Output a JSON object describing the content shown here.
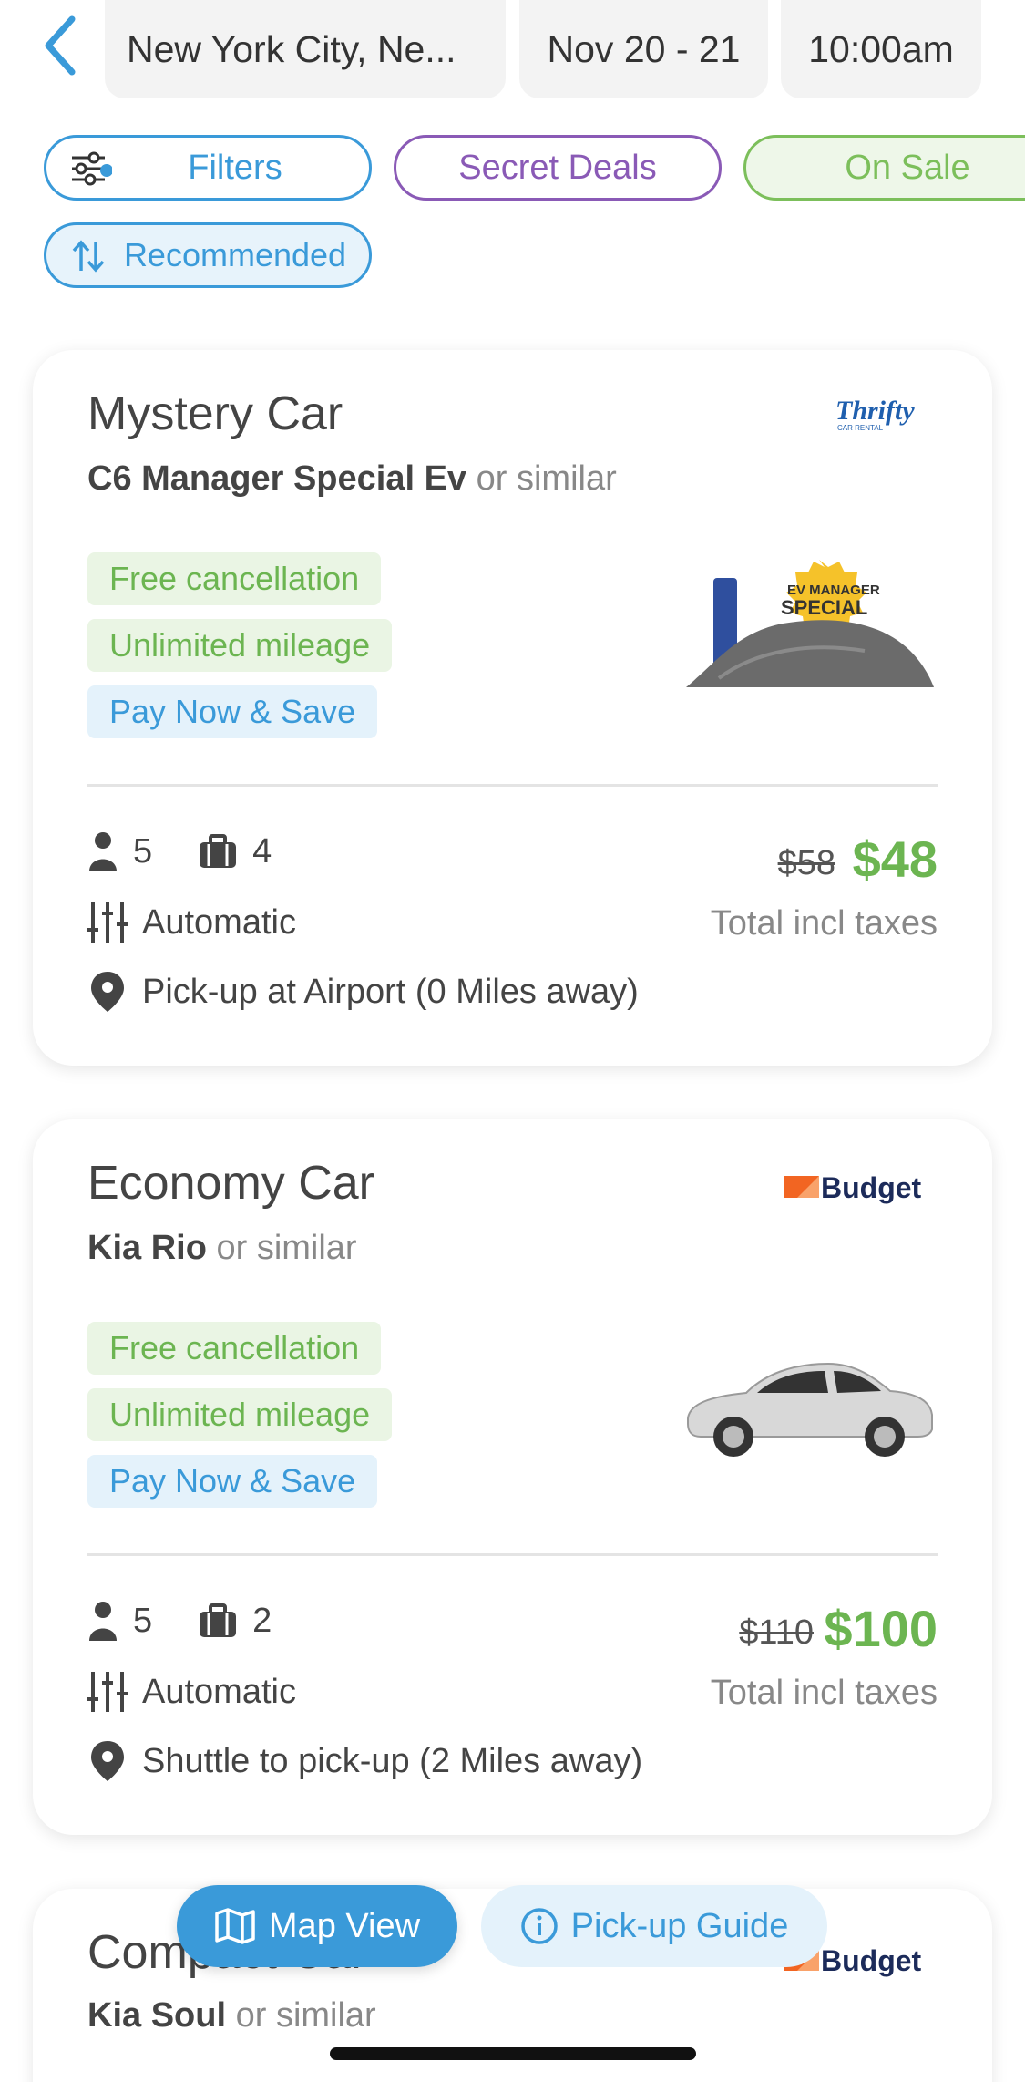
{
  "header": {
    "location": "New York City, Ne...",
    "dates": "Nov 20 - 21",
    "time": "10:00am"
  },
  "chips": {
    "filters": "Filters",
    "secret_deals": "Secret Deals",
    "on_sale": "On Sale",
    "sort": "Recommended"
  },
  "cards": [
    {
      "title": "Mystery Car",
      "model": "C6 Manager Special Ev",
      "similar": "or similar",
      "brand": "Thrifty",
      "brand_sub": "CAR RENTAL",
      "badge_top": "EV MANAGER",
      "badge_bottom": "SPECIAL",
      "tags": [
        "Free cancellation",
        "Unlimited mileage",
        "Pay Now & Save"
      ],
      "passengers": "5",
      "bags": "4",
      "transmission": "Automatic",
      "pickup": "Pick-up at Airport (0 Miles away)",
      "old_price": "$58",
      "price": "$48",
      "price_note": "Total incl taxes"
    },
    {
      "title": "Economy Car",
      "model": "Kia Rio",
      "similar": "or similar",
      "brand": "Budget",
      "tags": [
        "Free cancellation",
        "Unlimited mileage",
        "Pay Now & Save"
      ],
      "passengers": "5",
      "bags": "2",
      "transmission": "Automatic",
      "pickup": "Shuttle to pick-up (2 Miles away)",
      "old_price": "$110",
      "price": "$100",
      "price_note": "Total incl taxes"
    },
    {
      "title": "Compact Car",
      "model": "Kia Soul",
      "similar": "or similar",
      "brand": "Budget"
    }
  ],
  "actions": {
    "map_view": "Map View",
    "pickup_guide": "Pick-up Guide"
  },
  "colors": {
    "accent_blue": "#3a9ad9",
    "deal_purple": "#8a5ab6",
    "sale_green": "#7cbf5b",
    "price_green": "#6cb551"
  },
  "icons": [
    "chevron-left-icon",
    "sliders-icon",
    "sort-icon",
    "person-icon",
    "suitcase-icon",
    "transmission-icon",
    "location-pin-icon",
    "map-icon",
    "info-icon"
  ]
}
